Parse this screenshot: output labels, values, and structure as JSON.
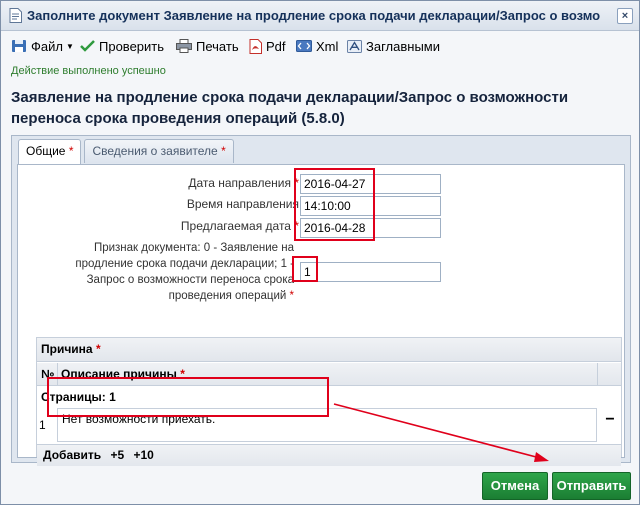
{
  "window": {
    "title": "Заполните документ Заявление на продление срока подачи декларации/Запрос о возмо",
    "close_label": "×"
  },
  "toolbar": {
    "file": "Файл",
    "check": "Проверить",
    "print": "Печать",
    "pdf": "Pdf",
    "xml": "Xml",
    "caps": "Заглавными"
  },
  "status": "Действие выполнено успешно",
  "heading": "Заявление на продление срока подачи декларации/Запрос о возможности переноса срока проведения операций (5.8.0)",
  "tabs": [
    {
      "label": "Общие",
      "required": "*"
    },
    {
      "label": "Сведения о заявителе",
      "required": "*"
    }
  ],
  "form": {
    "send_date": {
      "label": "Дата направления",
      "value": "2016-04-27"
    },
    "send_time": {
      "label": "Время направления",
      "value": "14:10:00"
    },
    "proposed_date": {
      "label": "Предлагаемая дата",
      "value": "2016-04-28"
    },
    "doc_sign": {
      "label": "Признак документа: 0 - Заявление на продление срока подачи декларации; 1 - Запрос о возможности переноса срока проведения операций",
      "value": "1"
    },
    "required_mark": "*"
  },
  "reason": {
    "title": "Причина",
    "col_num": "№",
    "col_desc": "Описание причины",
    "pages": "Страницы: 1",
    "row_number": "1",
    "row_value": "Нет возможности приехать.",
    "remove": "−",
    "add": "Добавить",
    "add5": "+5",
    "add10": "+10"
  },
  "buttons": {
    "cancel": "Отмена",
    "submit": "Отправить"
  },
  "colors": {
    "accent_green": "#1b7e33",
    "highlight_red": "#e0001b",
    "status_green": "#2e7d2e"
  }
}
